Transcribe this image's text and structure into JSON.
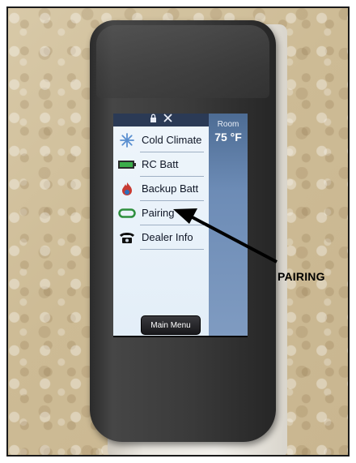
{
  "screen": {
    "status_icons": [
      "lock-icon",
      "tools-icon"
    ],
    "menu_items": [
      {
        "label": "Cold Climate",
        "icon": "snowflake-icon"
      },
      {
        "label": "RC Batt",
        "icon": "battery-icon"
      },
      {
        "label": "Backup Batt",
        "icon": "flame-icon"
      },
      {
        "label": "Pairing",
        "icon": "link-icon"
      },
      {
        "label": "Dealer Info",
        "icon": "phone-icon"
      }
    ],
    "room_label": "Room",
    "room_temp": "75 °F",
    "main_menu_label": "Main Menu"
  },
  "annotation": {
    "callout_text": "PAIRING"
  },
  "colors": {
    "panel_blue": "#6d8cb6",
    "header_blue": "#2b3a55",
    "menu_bg": "#e3eef8"
  }
}
